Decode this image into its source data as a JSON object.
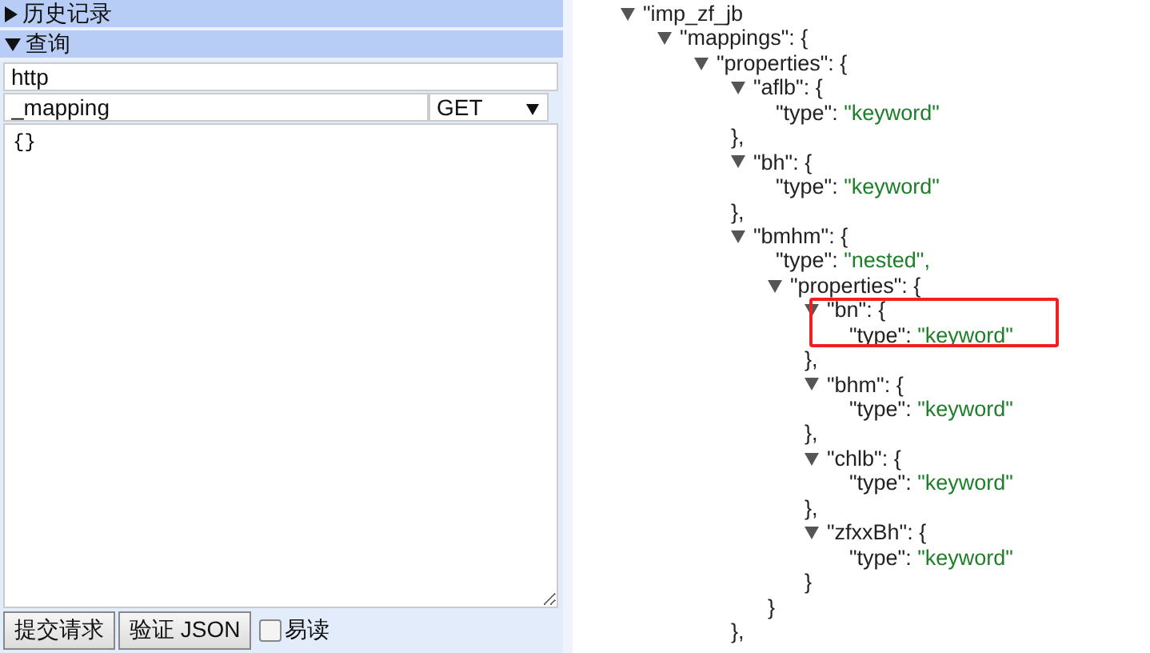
{
  "sidebar": {
    "sections": [
      {
        "title": "历史记录",
        "expanded": false
      },
      {
        "title": "查询",
        "expanded": true
      }
    ]
  },
  "query": {
    "url": "http",
    "path": "_mapping",
    "method": "GET",
    "body": "{}"
  },
  "buttons": [
    "提交请求",
    "验证 JSON"
  ],
  "readable": {
    "label": "易读",
    "checked": false
  },
  "tree": [
    {
      "open": "\"imp_zf_jb",
      "expanded": true,
      "children": [
        {
          "open": "\"mappings\": {",
          "expanded": true,
          "children": [
            {
              "open": "\"properties\": {",
              "expanded": true,
              "children": [
                {
                  "open": "\"aflb\": {",
                  "expanded": true,
                  "close": "},",
                  "children": [
                    {
                      "text": "\"type\": ",
                      "value": "\"keyword\""
                    }
                  ]
                },
                {
                  "open": "\"bh\": {",
                  "expanded": true,
                  "close": "},",
                  "children": [
                    {
                      "text": "\"type\": ",
                      "value": "\"keyword\""
                    }
                  ]
                },
                {
                  "open": "\"bmhm\": {",
                  "expanded": true,
                  "close": "},",
                  "children": [
                    {
                      "text": "\"type\": ",
                      "value": "\"nested\","
                    },
                    {
                      "open": "\"properties\": {",
                      "expanded": true,
                      "close": "}",
                      "children": [
                        {
                          "open": "\"bn\": {",
                          "expanded": true,
                          "highlighted": true,
                          "close": "},",
                          "children": [
                            {
                              "text": "\"type\": ",
                              "value": "\"keyword\""
                            }
                          ]
                        },
                        {
                          "open": "\"bhm\": {",
                          "expanded": true,
                          "close": "},",
                          "children": [
                            {
                              "text": "\"type\": ",
                              "value": "\"keyword\""
                            }
                          ]
                        },
                        {
                          "open": "\"chlb\": {",
                          "expanded": true,
                          "close": "},",
                          "children": [
                            {
                              "text": "\"type\": ",
                              "value": "\"keyword\""
                            }
                          ]
                        },
                        {
                          "open": "\"zfxxBh\": {",
                          "expanded": true,
                          "close": "}",
                          "children": [
                            {
                              "text": "\"type\": ",
                              "value": "\"keyword\""
                            }
                          ]
                        }
                      ]
                    }
                  ]
                }
              ]
            }
          ]
        }
      ]
    }
  ]
}
